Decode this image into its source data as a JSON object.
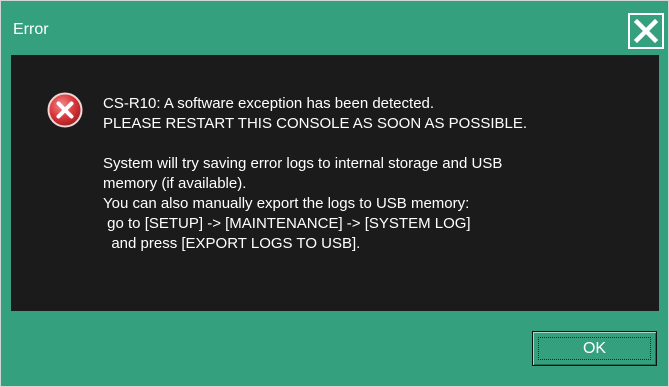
{
  "window": {
    "title": "Error",
    "close_icon": "close-icon"
  },
  "message": {
    "icon": "error-icon",
    "line1": "CS-R10: A software exception has been detected.",
    "line2": "PLEASE RESTART THIS CONSOLE AS SOON AS POSSIBLE.",
    "line3": "System will try saving error logs to internal storage and USB",
    "line4": "memory (if available).",
    "line5": "You can also manually export the logs to USB memory:",
    "line6": " go to [SETUP] -> [MAINTENANCE] -> [SYSTEM LOG]",
    "line7": "  and press [EXPORT LOGS TO USB]."
  },
  "buttons": {
    "ok_label": "OK"
  },
  "colors": {
    "frame": "#35a07d",
    "content_bg": "#1b1b1b",
    "error_icon": "#d9383c",
    "text": "#ffffff"
  }
}
